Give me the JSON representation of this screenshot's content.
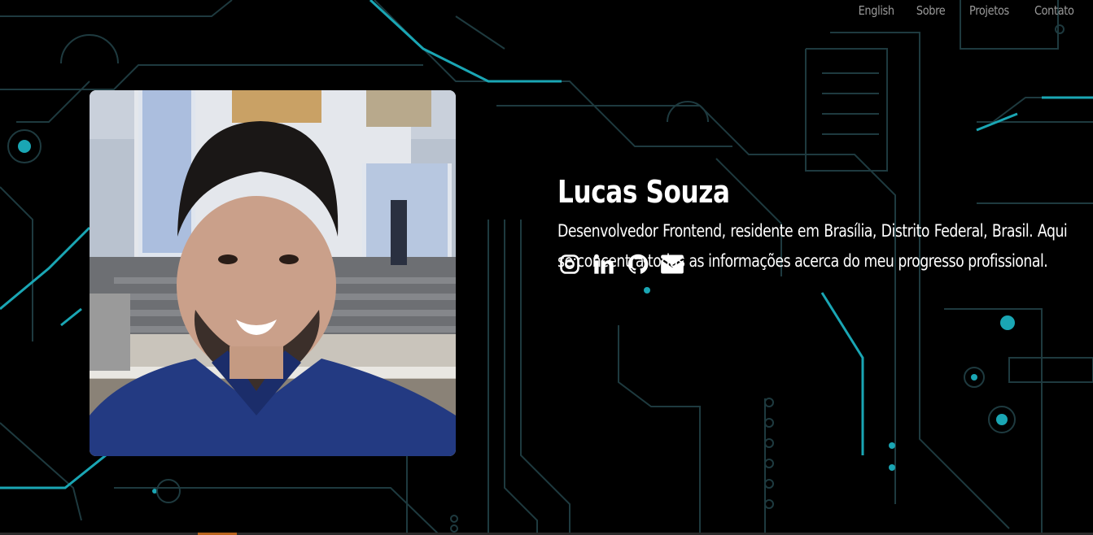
{
  "nav": {
    "items": [
      {
        "label": "English"
      },
      {
        "label": "Sobre"
      },
      {
        "label": "Projetos"
      },
      {
        "label": "Contato"
      }
    ]
  },
  "profile": {
    "name": "Lucas Souza",
    "bio": "Desenvolvedor Frontend, residente em Brasília, Distrito Federal, Brasil. Aqui se concentra todas as informações acerca do meu progresso profissional.",
    "photo_alt": "Lucas Souza"
  },
  "socials": [
    {
      "icon": "instagram-icon"
    },
    {
      "icon": "linkedin-icon"
    },
    {
      "icon": "github-icon"
    },
    {
      "icon": "envelope-icon"
    }
  ],
  "colors": {
    "background": "#000000",
    "circuit": "#1aa6b4",
    "circuit_dim": "#1f3b40",
    "text": "#ffffff",
    "nav_text": "#9a9a9a"
  }
}
